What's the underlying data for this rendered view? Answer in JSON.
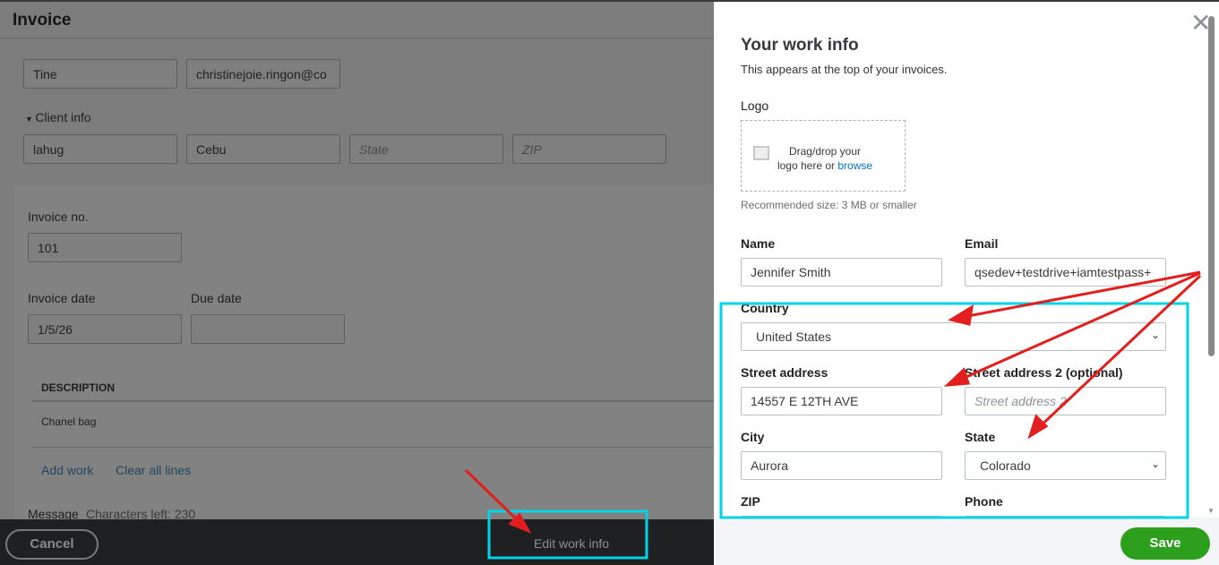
{
  "invoice": {
    "title": "Invoice",
    "client_name": "Tine",
    "client_email": "christinejoie.ringon@co",
    "client_info_label": "Client info",
    "street": "lahug",
    "city": "Cebu",
    "state_placeholder": "State",
    "zip_placeholder": "ZIP",
    "invoice_no_label": "Invoice no.",
    "invoice_no": "101",
    "invoice_date_label": "Invoice date",
    "invoice_date": "1/5/26",
    "due_date_label": "Due date",
    "due_date": "",
    "description_header": "DESCRIPTION",
    "line_item": "Chanel bag",
    "add_work": "Add work",
    "clear_lines": "Clear all lines",
    "message_label": "Message",
    "chars_left": "Characters left: 230"
  },
  "footer": {
    "cancel": "Cancel",
    "edit_work_info": "Edit work info",
    "save": "Save"
  },
  "work_info": {
    "title": "Your work info",
    "subtitle": "This appears at the top of your invoices.",
    "logo_label": "Logo",
    "drop_text": "Drag/drop your",
    "drop_text2": "logo here or",
    "browse": "browse",
    "recommended": "Recommended size: 3 MB or smaller",
    "name_label": "Name",
    "name": "Jennifer Smith",
    "email_label": "Email",
    "email": "qsedev+testdrive+iamtestpass+",
    "country_label": "Country",
    "country": "United States",
    "street_label": "Street address",
    "street": "14557 E 12TH AVE",
    "street2_label": "Street address 2 (optional)",
    "street2_placeholder": "Street address 2",
    "city_label": "City",
    "city": "Aurora",
    "state_label": "State",
    "state": "Colorado",
    "zip_label": "ZIP",
    "phone_label": "Phone"
  },
  "colors": {
    "annotation_box": "#00d4e8",
    "annotation_arrow": "#e31e1e",
    "save": "#2ca01c"
  }
}
